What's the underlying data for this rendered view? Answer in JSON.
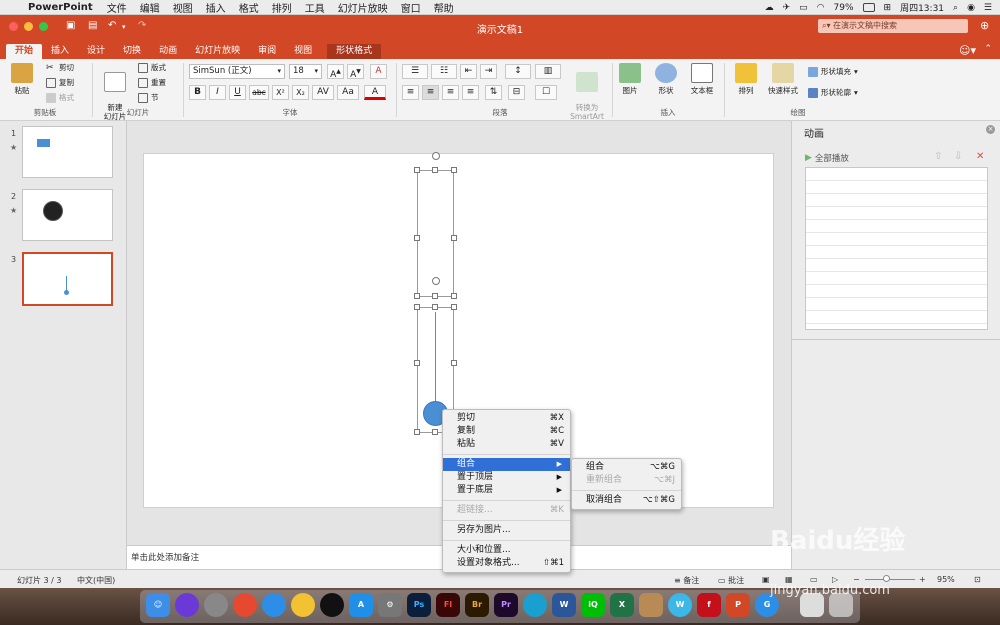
{
  "menubar": {
    "app": "PowerPoint",
    "menus": [
      "文件",
      "编辑",
      "视图",
      "插入",
      "格式",
      "排列",
      "工具",
      "幻灯片放映",
      "窗口",
      "帮助"
    ],
    "battery": "79%",
    "clock": "周四13:31"
  },
  "window": {
    "title": "演示文稿1",
    "search_placeholder": "在演示文稿中搜索"
  },
  "tabs": [
    "开始",
    "插入",
    "设计",
    "切换",
    "动画",
    "幻灯片放映",
    "审阅",
    "视图",
    "形状格式"
  ],
  "ribbon": {
    "clipboard": {
      "paste": "粘贴",
      "cut": "剪切",
      "copy": "复制",
      "format": "格式",
      "label": "剪贴板"
    },
    "slides": {
      "new_slide": "新建\n幻灯片",
      "layout": "版式",
      "reset": "重置",
      "section": "节",
      "label": "幻灯片"
    },
    "font": {
      "name": "SimSun (正文)",
      "size": "18",
      "label": "字体",
      "buttons": [
        "B",
        "I",
        "U",
        "abc",
        "X²",
        "X₂"
      ]
    },
    "paragraph": {
      "smartart": "转换为\nSmartArt",
      "label": "段落"
    },
    "insert": {
      "picture": "图片",
      "shapes": "形状",
      "textbox": "文本框",
      "label": "插入"
    },
    "drawing": {
      "arrange": "排列",
      "quick_styles": "快速样式",
      "fill": "形状填充",
      "outline": "形状轮廓",
      "label": "绘图"
    }
  },
  "slides": [
    {
      "num": "1",
      "star": "★"
    },
    {
      "num": "2",
      "star": "★"
    },
    {
      "num": "3",
      "star": ""
    }
  ],
  "notes": {
    "placeholder": "单击此处添加备注"
  },
  "animation_pane": {
    "title": "动画",
    "play_all": "全部播放"
  },
  "status": {
    "slide_info": "幻灯片 3 / 3",
    "language": "中文(中国)",
    "notes": "备注",
    "comments": "批注",
    "zoom": "95%"
  },
  "context_menu": {
    "items": [
      {
        "label": "剪切",
        "shortcut": "⌘X"
      },
      {
        "label": "复制",
        "shortcut": "⌘C"
      },
      {
        "label": "粘贴",
        "shortcut": "⌘V"
      },
      {
        "label": "组合",
        "shortcut": "▶"
      },
      {
        "label": "置于顶层",
        "shortcut": "▶"
      },
      {
        "label": "置于底层",
        "shortcut": "▶"
      },
      {
        "label": "超链接...",
        "shortcut": "⌘K"
      },
      {
        "label": "另存为图片...",
        "shortcut": ""
      },
      {
        "label": "大小和位置...",
        "shortcut": ""
      },
      {
        "label": "设置对象格式...",
        "shortcut": "⇧⌘1"
      }
    ]
  },
  "submenu": {
    "items": [
      {
        "label": "组合",
        "shortcut": "⌥⌘G"
      },
      {
        "label": "重新组合",
        "shortcut": "⌥⌘J"
      },
      {
        "label": "取消组合",
        "shortcut": "⌥⇧⌘G"
      }
    ]
  },
  "watermark": {
    "text": "Baidu经验",
    "url": "jingyan.baidu.com"
  },
  "colors": {
    "accent": "#d24726",
    "highlight": "#2f6fd6",
    "shape": "#4a8fd4"
  }
}
